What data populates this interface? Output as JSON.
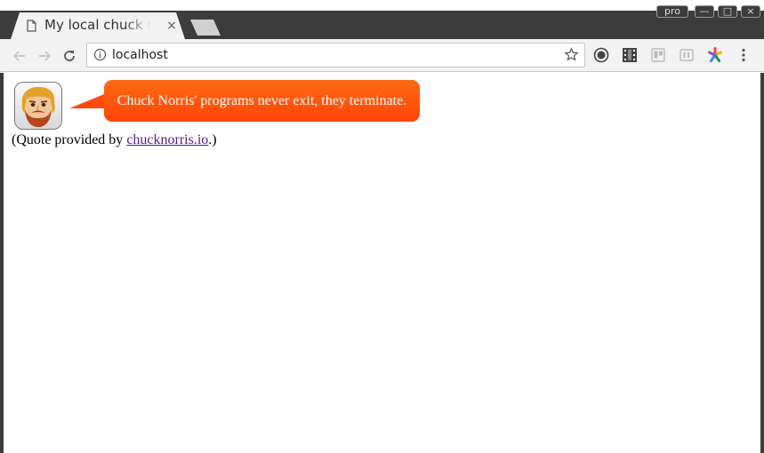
{
  "window": {
    "profile_label": "pro",
    "minimize_label": "—",
    "maximize_label": "□",
    "close_label": "×"
  },
  "tab": {
    "title": "My local chuck norris",
    "close_label": "×",
    "page_icon": "page-icon"
  },
  "toolbar": {
    "back_icon": "back-arrow-icon",
    "forward_icon": "forward-arrow-icon",
    "reload_icon": "reload-icon",
    "url": "localhost",
    "info_icon": "info-icon",
    "bookmark_icon": "star-icon",
    "extensions": [
      "record-extension-icon",
      "film-extension-icon",
      "board-extension-icon",
      "bi-extension-icon",
      "asterisk-extension-icon"
    ],
    "menu_icon": "kebab-menu-icon"
  },
  "page": {
    "quote": "Chuck Norris' programs never exit, they terminate.",
    "attribution_prefix": "(Quote provided by ",
    "attribution_link": "chucknorris.io",
    "attribution_suffix": ".)",
    "bubble_color": "#ff4a0c",
    "link_color": "#551a8b"
  }
}
